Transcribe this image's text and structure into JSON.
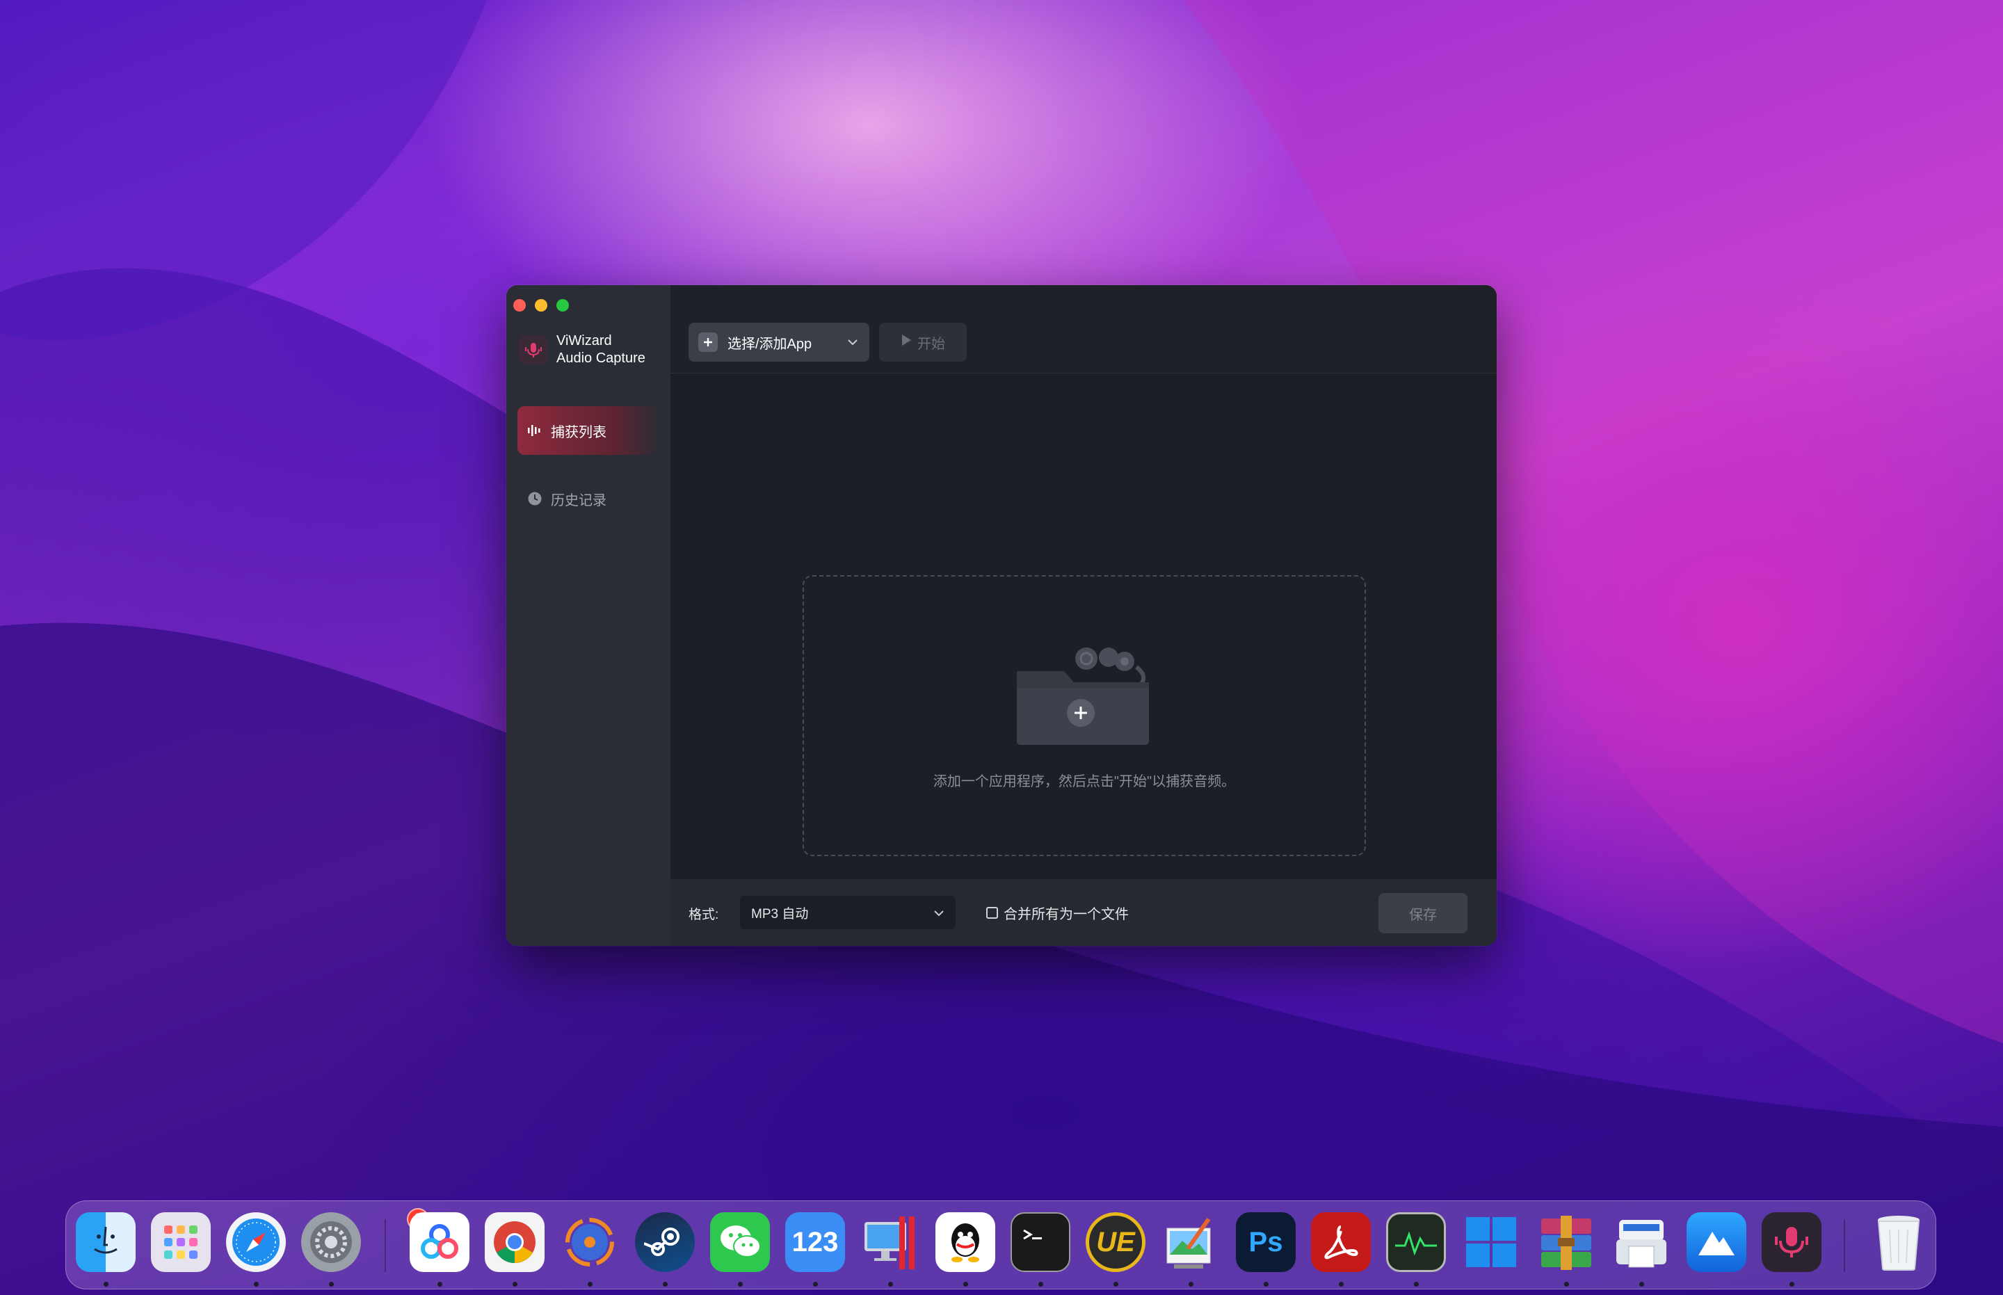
{
  "window": {
    "app_name_line1": "ViWizard",
    "app_name_line2": "Audio Capture"
  },
  "sidebar": {
    "items": [
      {
        "label": "捕获列表",
        "icon": "waveform-icon",
        "active": true
      },
      {
        "label": "历史记录",
        "icon": "clock-icon",
        "active": false
      }
    ]
  },
  "toolbar": {
    "add_label": "选择/添加App",
    "start_label": "开始"
  },
  "dropzone": {
    "hint": "添加一个应用程序，然后点击\"开始\"以捕获音频。"
  },
  "footer": {
    "format_label": "格式:",
    "format_value": "MP3 自动",
    "merge_label": "合并所有为一个文件",
    "merge_checked": false,
    "save_label": "保存"
  },
  "dock": {
    "settings_badge": "2",
    "number_app_label": "123",
    "ps_label": "Ps",
    "ue_label": "UE"
  },
  "colors": {
    "accent": "#8f2a3e",
    "window_bg": "#1e2128",
    "sidebar_bg": "#2a2d35"
  }
}
